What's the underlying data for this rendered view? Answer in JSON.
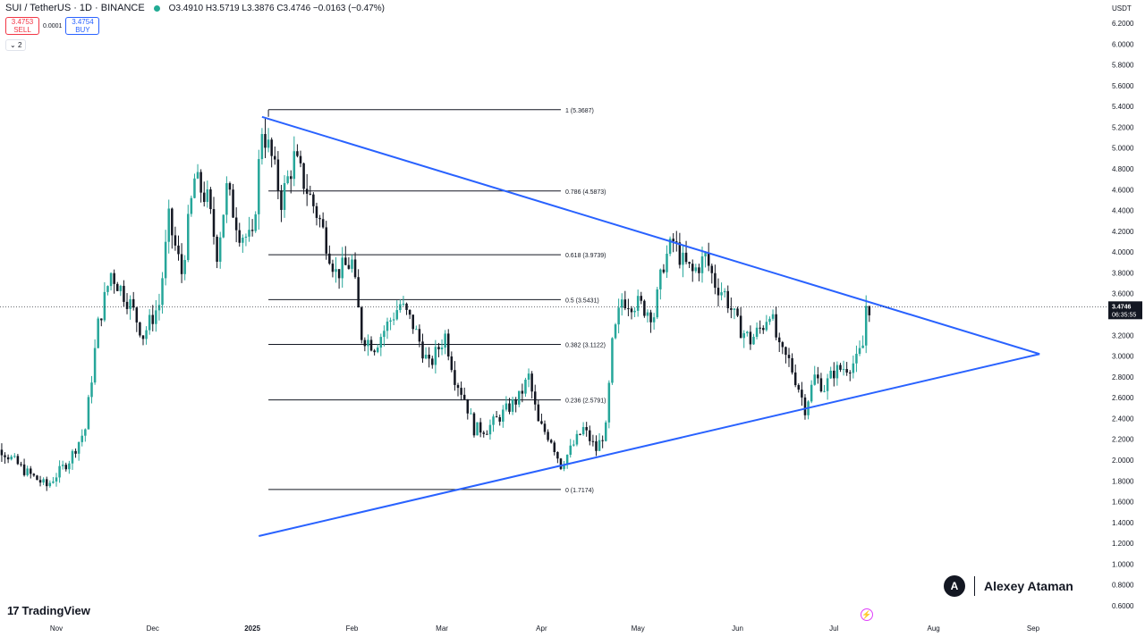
{
  "header": {
    "symbol": "SUI / TetherUS · 1D · BINANCE",
    "ohlc": "O3.4910 H3.5719 L3.3876 C3.4746 −0.0163 (−0.47%)",
    "live_color": "#22ab94"
  },
  "trade": {
    "sell_price": "3.4753",
    "sell_label": "SELL",
    "spread": "0.0001",
    "buy_price": "3.4754",
    "buy_label": "BUY"
  },
  "indicator_count": "2",
  "branding": {
    "logo_text": "TradingView",
    "logo_icon": "tradingview-logo-icon",
    "author": "Alexey Ataman",
    "author_icon": "author-logo-icon",
    "bolt_icon": "lightning-icon"
  },
  "chart_data": {
    "type": "candlestick",
    "ylabel": "USDT",
    "ylim": [
      0.5,
      6.3
    ],
    "grid": false,
    "y_ticks": [
      "6.2000",
      "6.0000",
      "5.8000",
      "5.6000",
      "5.4000",
      "5.2000",
      "5.0000",
      "4.8000",
      "4.6000",
      "4.4000",
      "4.2000",
      "4.0000",
      "3.8000",
      "3.6000",
      "3.4000",
      "3.2000",
      "3.0000",
      "2.8000",
      "2.6000",
      "2.4000",
      "2.2000",
      "2.0000",
      "1.8000",
      "1.6000",
      "1.4000",
      "1.2000",
      "1.0000",
      "0.8000",
      "0.6000"
    ],
    "x_ticks": [
      {
        "label": "Nov",
        "date": "2024-11-01"
      },
      {
        "label": "Dec",
        "date": "2024-12-01"
      },
      {
        "label": "2025",
        "date": "2025-01-01"
      },
      {
        "label": "Feb",
        "date": "2025-02-01"
      },
      {
        "label": "Mar",
        "date": "2025-03-01"
      },
      {
        "label": "Apr",
        "date": "2025-04-01"
      },
      {
        "label": "May",
        "date": "2025-05-01"
      },
      {
        "label": "Jun",
        "date": "2025-06-01"
      },
      {
        "label": "Jul",
        "date": "2025-07-01"
      },
      {
        "label": "Aug",
        "date": "2025-08-01"
      },
      {
        "label": "Sep",
        "date": "2025-09-01"
      }
    ],
    "x_range": [
      "2024-10-08",
      "2025-09-28"
    ],
    "current_price": "3.4746",
    "countdown": "06:35:55",
    "current_price_value": 3.4746,
    "colors": {
      "up": "#26a69a",
      "down": "#131722",
      "trend": "#2962ff",
      "fib": "#131722",
      "price_label": "#131722"
    },
    "series_anchor_points": [
      {
        "date": "2024-10-08",
        "price": 2.05
      },
      {
        "date": "2024-10-15",
        "price": 2.1
      },
      {
        "date": "2024-10-22",
        "price": 1.9
      },
      {
        "date": "2024-10-29",
        "price": 1.75
      },
      {
        "date": "2024-11-05",
        "price": 2.0
      },
      {
        "date": "2024-11-10",
        "price": 2.3
      },
      {
        "date": "2024-11-14",
        "price": 3.3
      },
      {
        "date": "2024-11-18",
        "price": 3.8
      },
      {
        "date": "2024-11-24",
        "price": 3.5
      },
      {
        "date": "2024-11-28",
        "price": 3.2
      },
      {
        "date": "2024-12-03",
        "price": 3.5
      },
      {
        "date": "2024-12-06",
        "price": 4.3
      },
      {
        "date": "2024-12-10",
        "price": 3.8
      },
      {
        "date": "2024-12-14",
        "price": 4.7
      },
      {
        "date": "2024-12-18",
        "price": 4.5
      },
      {
        "date": "2024-12-21",
        "price": 4.0
      },
      {
        "date": "2024-12-24",
        "price": 4.6
      },
      {
        "date": "2024-12-28",
        "price": 4.2
      },
      {
        "date": "2025-01-01",
        "price": 4.1
      },
      {
        "date": "2025-01-04",
        "price": 5.2
      },
      {
        "date": "2025-01-07",
        "price": 4.9
      },
      {
        "date": "2025-01-10",
        "price": 4.5
      },
      {
        "date": "2025-01-14",
        "price": 4.9
      },
      {
        "date": "2025-01-18",
        "price": 4.6
      },
      {
        "date": "2025-01-22",
        "price": 4.3
      },
      {
        "date": "2025-01-27",
        "price": 3.8
      },
      {
        "date": "2025-02-01",
        "price": 3.9
      },
      {
        "date": "2025-02-04",
        "price": 3.2
      },
      {
        "date": "2025-02-08",
        "price": 3.1
      },
      {
        "date": "2025-02-12",
        "price": 3.3
      },
      {
        "date": "2025-02-16",
        "price": 3.5
      },
      {
        "date": "2025-02-20",
        "price": 3.3
      },
      {
        "date": "2025-02-25",
        "price": 2.9
      },
      {
        "date": "2025-03-02",
        "price": 3.2
      },
      {
        "date": "2025-03-05",
        "price": 2.8
      },
      {
        "date": "2025-03-08",
        "price": 2.6
      },
      {
        "date": "2025-03-11",
        "price": 2.3
      },
      {
        "date": "2025-03-15",
        "price": 2.3
      },
      {
        "date": "2025-03-20",
        "price": 2.45
      },
      {
        "date": "2025-03-25",
        "price": 2.6
      },
      {
        "date": "2025-03-28",
        "price": 2.8
      },
      {
        "date": "2025-03-31",
        "price": 2.35
      },
      {
        "date": "2025-04-04",
        "price": 2.2
      },
      {
        "date": "2025-04-07",
        "price": 1.95
      },
      {
        "date": "2025-04-10",
        "price": 2.1
      },
      {
        "date": "2025-04-14",
        "price": 2.3
      },
      {
        "date": "2025-04-18",
        "price": 2.1
      },
      {
        "date": "2025-04-21",
        "price": 2.3
      },
      {
        "date": "2025-04-23",
        "price": 3.1
      },
      {
        "date": "2025-04-26",
        "price": 3.55
      },
      {
        "date": "2025-05-01",
        "price": 3.5
      },
      {
        "date": "2025-05-06",
        "price": 3.4
      },
      {
        "date": "2025-05-09",
        "price": 3.9
      },
      {
        "date": "2025-05-12",
        "price": 4.1
      },
      {
        "date": "2025-05-15",
        "price": 3.9
      },
      {
        "date": "2025-05-18",
        "price": 3.8
      },
      {
        "date": "2025-05-22",
        "price": 3.95
      },
      {
        "date": "2025-05-25",
        "price": 3.7
      },
      {
        "date": "2025-05-28",
        "price": 3.6
      },
      {
        "date": "2025-06-01",
        "price": 3.3
      },
      {
        "date": "2025-06-05",
        "price": 3.15
      },
      {
        "date": "2025-06-09",
        "price": 3.3
      },
      {
        "date": "2025-06-11",
        "price": 3.45
      },
      {
        "date": "2025-06-14",
        "price": 3.05
      },
      {
        "date": "2025-06-17",
        "price": 2.95
      },
      {
        "date": "2025-06-20",
        "price": 2.7
      },
      {
        "date": "2025-06-22",
        "price": 2.5
      },
      {
        "date": "2025-06-25",
        "price": 2.8
      },
      {
        "date": "2025-06-28",
        "price": 2.7
      },
      {
        "date": "2025-07-01",
        "price": 2.85
      },
      {
        "date": "2025-07-05",
        "price": 2.9
      },
      {
        "date": "2025-07-08",
        "price": 2.95
      },
      {
        "date": "2025-07-10",
        "price": 3.1
      },
      {
        "date": "2025-07-11",
        "price": 3.49
      },
      {
        "date": "2025-07-12",
        "price": 3.4746
      }
    ],
    "fibonacci": {
      "start_date": "2025-01-06",
      "end_date": "2025-04-07",
      "levels": [
        {
          "label": "1 (5.3687)",
          "value": 5.3687
        },
        {
          "label": "0.786 (4.5873)",
          "value": 4.5873
        },
        {
          "label": "0.618 (3.9739)",
          "value": 3.9739
        },
        {
          "label": "0.5 (3.5431)",
          "value": 3.5431
        },
        {
          "label": "0.382 (3.1122)",
          "value": 3.1122
        },
        {
          "label": "0.236 (2.5791)",
          "value": 2.5791
        },
        {
          "label": "0 (1.7174)",
          "value": 1.7174
        }
      ]
    },
    "trendlines": [
      {
        "name": "upper",
        "from": {
          "date": "2025-01-04",
          "price": 5.3
        },
        "to": {
          "date": "2025-09-03",
          "price": 3.02
        }
      },
      {
        "name": "lower",
        "from": {
          "date": "2025-01-03",
          "price": 1.27
        },
        "to": {
          "date": "2025-09-03",
          "price": 3.02
        }
      }
    ]
  }
}
